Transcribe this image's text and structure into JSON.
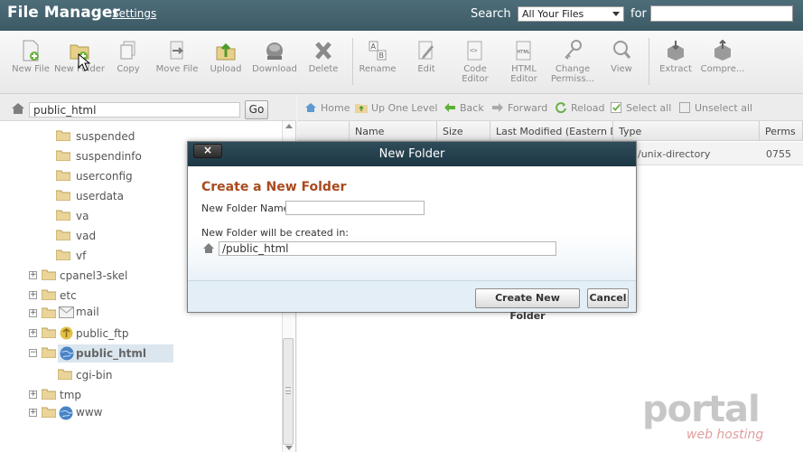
{
  "header": {
    "title": "File Manager",
    "settings_label": "Settings",
    "search_label": "Search",
    "search_scope": "All Your Files",
    "for_label": "for",
    "search_query": ""
  },
  "toolbar": {
    "new_file": "New File",
    "new_folder": "New Folder",
    "copy": "Copy",
    "move_file": "Move File",
    "upload": "Upload",
    "download": "Download",
    "delete": "Delete",
    "rename": "Rename",
    "edit": "Edit",
    "code_editor": "Code Editor",
    "html_editor": "HTML Editor",
    "change_permissions": "Change Permiss...",
    "view": "View",
    "extract": "Extract",
    "compress": "Compre..."
  },
  "left": {
    "path": "public_html",
    "go_label": "Go",
    "tree": [
      {
        "label": "suspended"
      },
      {
        "label": "suspendinfo"
      },
      {
        "label": "userconfig"
      },
      {
        "label": "userdata"
      },
      {
        "label": "va"
      },
      {
        "label": "vad"
      },
      {
        "label": "vf"
      },
      {
        "label": "cpanel3-skel"
      },
      {
        "label": "etc"
      },
      {
        "label": "mail"
      },
      {
        "label": "public_ftp"
      },
      {
        "label": "public_html"
      },
      {
        "label": "cgi-bin"
      },
      {
        "label": "tmp"
      },
      {
        "label": "www"
      }
    ]
  },
  "nav": {
    "home": "Home",
    "up_one_level": "Up One Level",
    "back": "Back",
    "forward": "Forward",
    "reload": "Reload",
    "select_all": "Select all",
    "unselect_all": "Unselect all"
  },
  "table": {
    "columns": [
      "Name",
      "Size",
      "Last Modified (Eastern Da",
      "Type",
      "Perms"
    ],
    "rows": [
      {
        "type": "d/unix-directory",
        "perms": "0755"
      }
    ]
  },
  "modal": {
    "title": "New Folder",
    "close_label": "×",
    "heading": "Create a New Folder",
    "name_label": "New Folder Name:",
    "name_value": "",
    "location_label": "New Folder will be created in:",
    "location_value": "/public_html",
    "create_button": "Create New Folder",
    "cancel_button": "Cancel"
  },
  "watermark": {
    "brand": "portal",
    "tagline": "web hosting"
  },
  "colors": {
    "header_bg": "#4d6d79",
    "modal_title_bg": "#1d3744",
    "heading_accent": "#a94a1e"
  }
}
